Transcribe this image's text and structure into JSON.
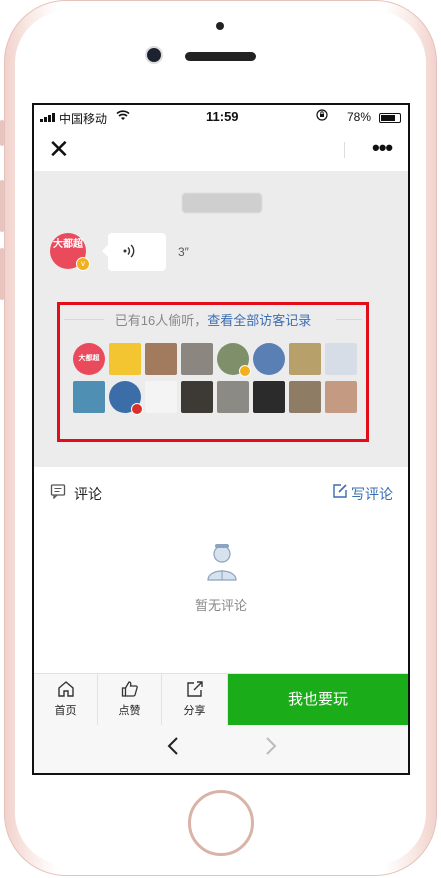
{
  "status": {
    "carrier": "中国移动",
    "time": "11:59",
    "battery": "78%"
  },
  "nav": {
    "close_icon": "close-icon",
    "more": "•••"
  },
  "chat": {
    "time_label": "",
    "avatar_text": "大都超",
    "avatar_sub": "",
    "voice_duration": "3″"
  },
  "visitors": {
    "prefix": "已有16人偷听，",
    "link": "查看全部访客记录",
    "avatars": [
      {
        "bg": "#e94b5c",
        "round": true,
        "text": "大都超"
      },
      {
        "bg": "#f3c531",
        "round": false,
        "text": ""
      },
      {
        "bg": "#a27b5f",
        "round": false,
        "text": ""
      },
      {
        "bg": "#8b8680",
        "round": false,
        "text": ""
      },
      {
        "bg": "#7f8f6a",
        "round": true,
        "text": "",
        "badge": "#f2b01e"
      },
      {
        "bg": "#5a7fb4",
        "round": true,
        "text": ""
      },
      {
        "bg": "#b8a06a",
        "round": false,
        "text": ""
      },
      {
        "bg": "#d6dde6",
        "round": false,
        "text": ""
      },
      {
        "bg": "#4f8fb3",
        "round": false,
        "text": ""
      },
      {
        "bg": "#3b6ea8",
        "round": true,
        "text": "",
        "badge": "#d9302c"
      },
      {
        "bg": "#f4f4f4",
        "round": false,
        "text": ""
      },
      {
        "bg": "#3d3a36",
        "round": false,
        "text": ""
      },
      {
        "bg": "#8c8a84",
        "round": false,
        "text": ""
      },
      {
        "bg": "#2b2b2b",
        "round": false,
        "text": ""
      },
      {
        "bg": "#8f7c64",
        "round": false,
        "text": ""
      },
      {
        "bg": "#c59a83",
        "round": false,
        "text": ""
      }
    ]
  },
  "comments": {
    "title": "评论",
    "write": "写评论",
    "empty": "暂无评论"
  },
  "tabbar": {
    "home": "首页",
    "like": "点赞",
    "share": "分享",
    "cta": "我也要玩"
  },
  "browser": {
    "back": "‹",
    "forward": "›"
  }
}
